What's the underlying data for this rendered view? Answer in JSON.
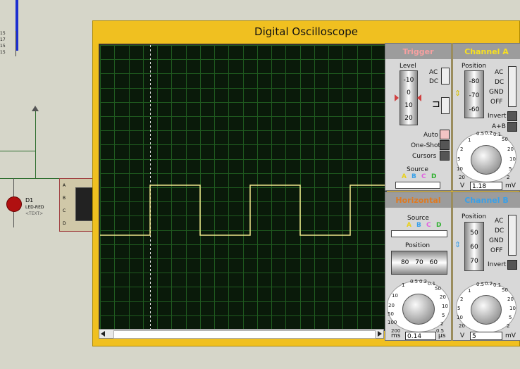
{
  "schematic": {
    "pin_labels": [
      "15",
      "17",
      "15",
      "15"
    ],
    "component_ref": "D1",
    "component_value": "LED-RED",
    "component_text": "<TEXT>",
    "scope_pins": [
      "A",
      "B",
      "C",
      "D"
    ]
  },
  "window": {
    "title": "Digital Oscilloscope"
  },
  "trigger": {
    "title": "Trigger",
    "level_label": "Level",
    "level_ticks": [
      "-10",
      "0",
      "10",
      "20"
    ],
    "ac": "AC",
    "dc": "DC",
    "auto": "Auto",
    "one_shot": "One-Shot",
    "cursors": "Cursors",
    "source_label": "Source",
    "sources": [
      "A",
      "B",
      "C",
      "D"
    ]
  },
  "channel_a": {
    "title": "Channel A",
    "position_label": "Position",
    "position_ticks": [
      "-80",
      "-70",
      "-60"
    ],
    "ac": "AC",
    "dc": "DC",
    "gnd": "GND",
    "off": "OFF",
    "invert": "Invert",
    "a_plus_b": "A+B",
    "dial_ticks": [
      "0.5",
      "0.2",
      "0.1",
      "50",
      "20",
      "10",
      "5",
      "2",
      "1",
      "2",
      "5",
      "10",
      "20"
    ],
    "unit_left": "V",
    "unit_right": "mV",
    "value": "1.18"
  },
  "horizontal": {
    "title": "Horizontal",
    "source_label": "Source",
    "sources": [
      "A",
      "B",
      "C",
      "D"
    ],
    "position_label": "Position",
    "position_ticks": [
      "80",
      "70",
      "60"
    ],
    "dial_ticks": [
      "0.5",
      "0.2",
      "0.1",
      "50",
      "20",
      "10",
      "5",
      "2",
      "1",
      "0.5",
      "200",
      "100",
      "50",
      "20",
      "10"
    ],
    "unit_left": "ms",
    "unit_right": "µs",
    "value": "0.14"
  },
  "channel_b": {
    "title": "Channel B",
    "position_label": "Position",
    "position_ticks": [
      "50",
      "60",
      "70"
    ],
    "ac": "AC",
    "dc": "DC",
    "gnd": "GND",
    "off": "OFF",
    "invert": "Invert",
    "dial_ticks": [
      "0.5",
      "0.2",
      "0.1",
      "50",
      "20",
      "10",
      "5",
      "2",
      "1",
      "2",
      "5",
      "10",
      "20"
    ],
    "unit_left": "V",
    "unit_right": "mV",
    "value": "5"
  },
  "colors": {
    "trace": "#f0e68c",
    "grid": "#1f5a1f",
    "trigger_title": "#f6a0a0",
    "channel_a_title": "#f8e020",
    "horizontal_title": "#e07a20",
    "channel_b_title": "#3aa0e8",
    "source_a": "#e8d020",
    "source_b": "#3aa0e8",
    "source_c": "#e060e0",
    "source_d": "#30b030"
  }
}
